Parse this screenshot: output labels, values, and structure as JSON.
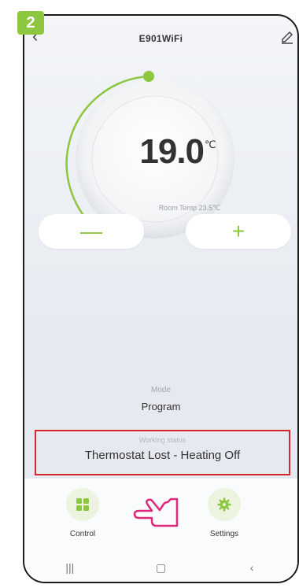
{
  "step_badge": "2",
  "header": {
    "title": "E901WiFi",
    "back_icon": "chevron-left-icon",
    "edit_icon": "pencil-icon"
  },
  "thermostat": {
    "set_temp": "19.0",
    "unit": "℃",
    "room_temp": "Room Temp 23.5℃"
  },
  "controls": {
    "minus": "—",
    "plus": "+"
  },
  "mode": {
    "label": "Mode",
    "value": "Program"
  },
  "working_status": {
    "label": "Working status",
    "value": "Thermostat Lost - Heating Off"
  },
  "bottom_nav": [
    {
      "label": "Control",
      "icon": "grid-icon"
    },
    {
      "label": "Settings",
      "icon": "gear-icon"
    }
  ],
  "system_nav": {
    "recents": "|||",
    "home": "▢",
    "back": "‹"
  },
  "colors": {
    "accent": "#8dc63f",
    "highlight_border": "#d7262e",
    "pointer_hand": "#e0287d"
  }
}
